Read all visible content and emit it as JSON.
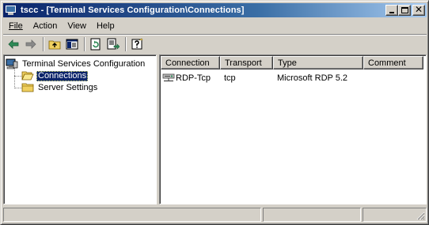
{
  "window": {
    "title": "tscc - [Terminal Services Configuration\\Connections]"
  },
  "menu": [
    {
      "label": "File"
    },
    {
      "label": "Action"
    },
    {
      "label": "View"
    },
    {
      "label": "Help"
    }
  ],
  "toolbar": {
    "icons": [
      "back-arrow-icon",
      "forward-arrow-icon",
      "up-folder-icon",
      "show-hide-tree-icon",
      "refresh-icon",
      "export-list-icon",
      "help-icon"
    ]
  },
  "tree": {
    "root": "Terminal Services Configuration",
    "children": [
      {
        "label": "Connections",
        "selected": true
      },
      {
        "label": "Server Settings",
        "selected": false
      }
    ]
  },
  "list": {
    "columns": [
      "Connection",
      "Transport",
      "Type",
      "Comment"
    ],
    "rows": [
      {
        "connection": "RDP-Tcp",
        "transport": "tcp",
        "type": "Microsoft RDP 5.2",
        "comment": ""
      }
    ]
  },
  "colors": {
    "title_gradient_start": "#0a246a",
    "title_gradient_end": "#a6caf0",
    "selection": "#0a246a",
    "face": "#d4d0c8"
  }
}
